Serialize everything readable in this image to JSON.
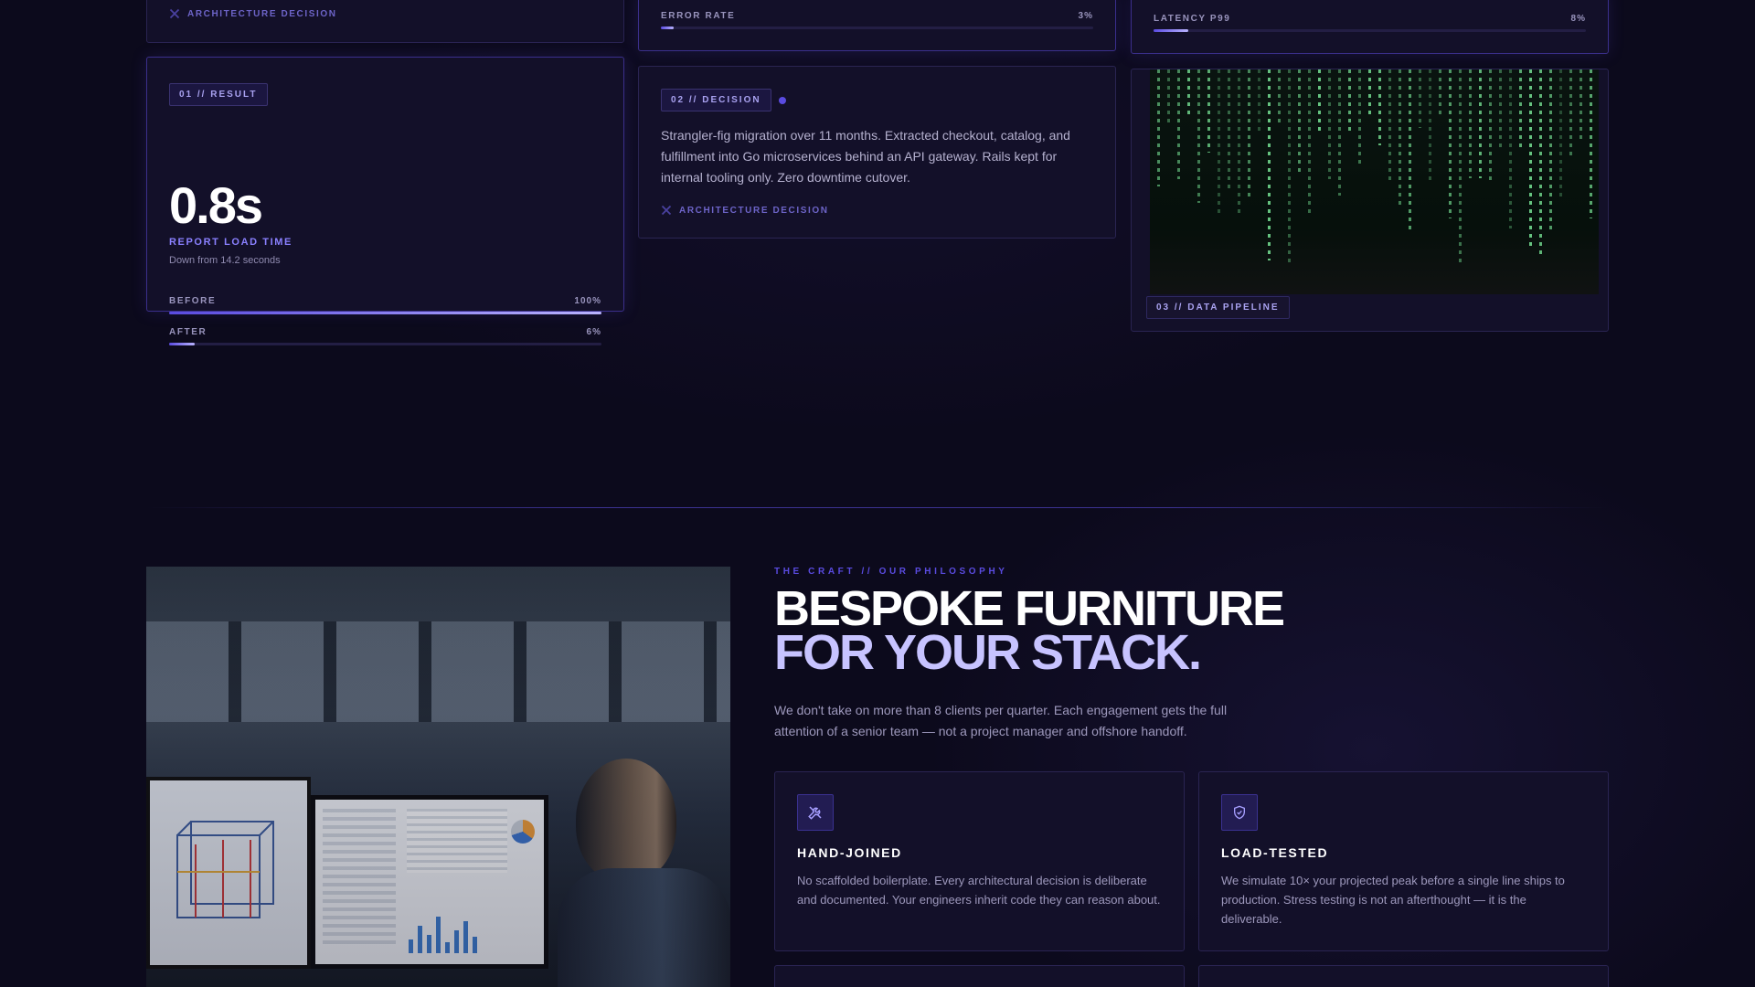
{
  "top_row": {
    "card1": {
      "tag_text": "ARCHITECTURE DECISION"
    },
    "card2": {
      "metric_label": "ERROR RATE",
      "metric_value": "3%",
      "metric_fraction": 0.03
    },
    "card3": {
      "metric_label": "LATENCY P99",
      "metric_value": "8%",
      "metric_fraction": 0.08
    }
  },
  "result_card": {
    "tag": "01 // RESULT",
    "big_value": "0.8s",
    "label": "REPORT LOAD TIME",
    "sub": "Down from 14.2 seconds",
    "before_label": "BEFORE",
    "before_value": "100%",
    "before_fraction": 1.0,
    "after_label": "AFTER",
    "after_value": "6%",
    "after_fraction": 0.06
  },
  "decision_card": {
    "tag": "02 // DECISION",
    "body": "Strangler-fig migration over 11 months. Extracted checkout, catalog, and fulfillment into Go microservices behind an API gateway. Rails kept for internal tooling only. Zero downtime cutover.",
    "footer": "ARCHITECTURE DECISION"
  },
  "pipeline_card": {
    "tag": "03 // DATA PIPELINE"
  },
  "craft": {
    "eyebrow": "THE CRAFT // OUR PHILOSOPHY",
    "headline_line1": "BESPOKE FURNITURE",
    "headline_line2": "FOR YOUR STACK.",
    "intro": "We don't take on more than 8 clients per quarter. Each engagement gets the full attention of a senior team — not a project manager and offshore handoff.",
    "features": [
      {
        "icon": "tools-icon",
        "title": "HAND-JOINED",
        "body": "No scaffolded boilerplate. Every architectural decision is deliberate and documented. Your engineers inherit code they can reason about."
      },
      {
        "icon": "shield-check-icon",
        "title": "LOAD-TESTED",
        "body": "We simulate 10× your projected peak before a single line ships to production. Stress testing is not an afterthought — it is the deliverable."
      }
    ]
  },
  "colors": {
    "accent": "#5a4be0",
    "accent_light": "#b9b3ff",
    "background": "#0c0a1c",
    "card": "#131029",
    "headline_secondary": "#c7c3ff"
  }
}
